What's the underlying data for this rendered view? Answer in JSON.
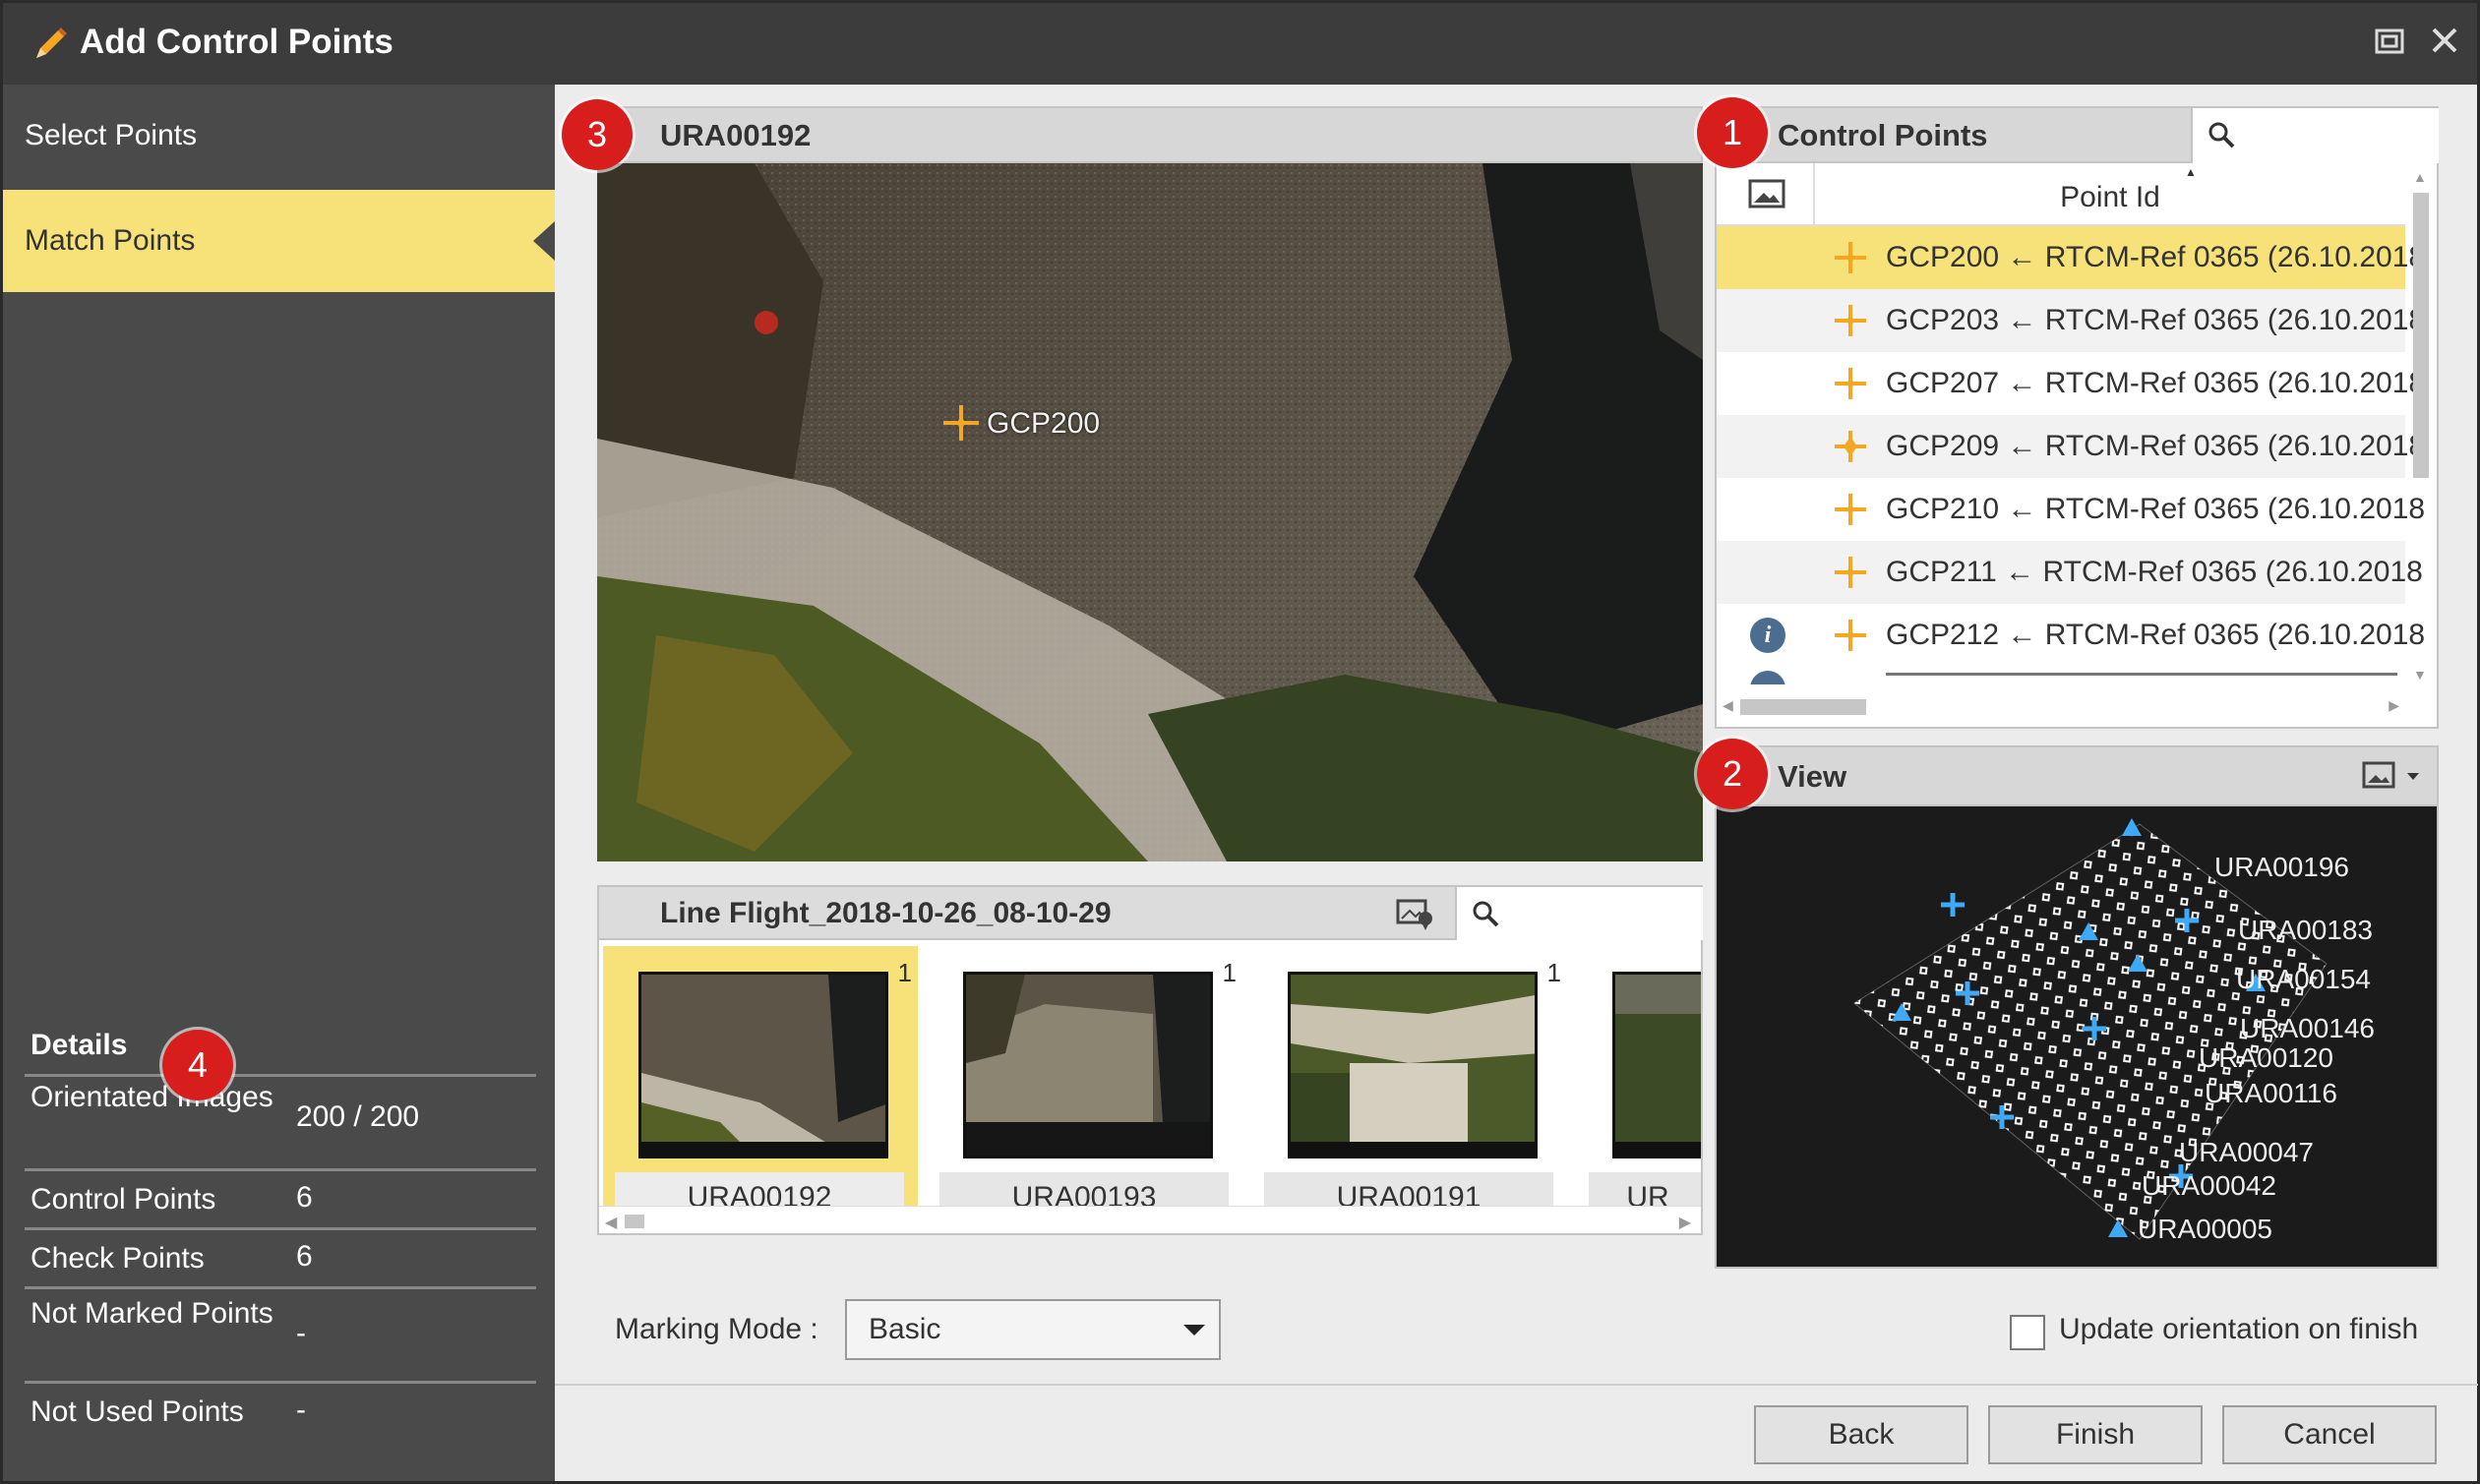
{
  "window": {
    "title": "Add Control Points",
    "restore_icon": "restore-window-icon",
    "close_icon": "close-icon"
  },
  "sidebar": {
    "steps": [
      {
        "label": "Select Points",
        "active": false
      },
      {
        "label": "Match Points",
        "active": true
      }
    ],
    "details": {
      "title": "Details",
      "rows": [
        {
          "key": "Orientated Images",
          "value": "200 / 200"
        },
        {
          "key": "Control Points",
          "value": "6"
        },
        {
          "key": "Check Points",
          "value": "6"
        },
        {
          "key": "Not Marked Points",
          "value": "-"
        },
        {
          "key": "Not Used Points",
          "value": "-"
        }
      ]
    }
  },
  "badges": [
    "1",
    "2",
    "3",
    "4"
  ],
  "image_panel": {
    "title": "URA00192",
    "marker_label": "GCP200"
  },
  "flight_strip": {
    "title": "Line Flight_2018-10-26_08-10-29",
    "search_placeholder": "",
    "thumbnails": [
      {
        "label": "URA00192",
        "count": "1",
        "selected": true
      },
      {
        "label": "URA00193",
        "count": "1",
        "selected": false
      },
      {
        "label": "URA00191",
        "count": "1",
        "selected": false
      },
      {
        "label": "UR",
        "count": "",
        "selected": false
      }
    ]
  },
  "control_points": {
    "title": "Control Points",
    "column_header": "Point Id",
    "search_placeholder": "",
    "rows": [
      {
        "text": "GCP200 ← RTCM-Ref 0365 (26.10.2018",
        "selected": true,
        "info": false
      },
      {
        "text": "GCP203 ← RTCM-Ref 0365 (26.10.2018",
        "selected": false,
        "info": false
      },
      {
        "text": "GCP207 ← RTCM-Ref 0365 (26.10.2018",
        "selected": false,
        "info": false
      },
      {
        "text": "GCP209 ← RTCM-Ref 0365 (26.10.2018",
        "selected": false,
        "info": false
      },
      {
        "text": "GCP210 ← RTCM-Ref 0365 (26.10.2018",
        "selected": false,
        "info": false
      },
      {
        "text": "GCP211 ← RTCM-Ref 0365 (26.10.2018",
        "selected": false,
        "info": false
      },
      {
        "text": "GCP212 ← RTCM-Ref 0365 (26.10.2018",
        "selected": false,
        "info": true
      }
    ]
  },
  "view_panel": {
    "title": "View",
    "labels": [
      "URA00196",
      "URA00183",
      "URA00154",
      "URA00146",
      "URA00120",
      "URA00116",
      "URA00047",
      "URA00042",
      "URA00005"
    ]
  },
  "bottom": {
    "marking_mode_label": "Marking Mode :",
    "marking_mode_value": "Basic",
    "update_orientation_label": "Update orientation on finish"
  },
  "buttons": {
    "back": "Back",
    "finish": "Finish",
    "cancel": "Cancel"
  },
  "colors": {
    "selection": "#f7e27a",
    "sidebar": "#4a4a4a",
    "titlebar": "#3c3c3c",
    "badge": "#d81d1d",
    "marker": "#f5a623",
    "view_triangle": "#3fa9f5"
  }
}
